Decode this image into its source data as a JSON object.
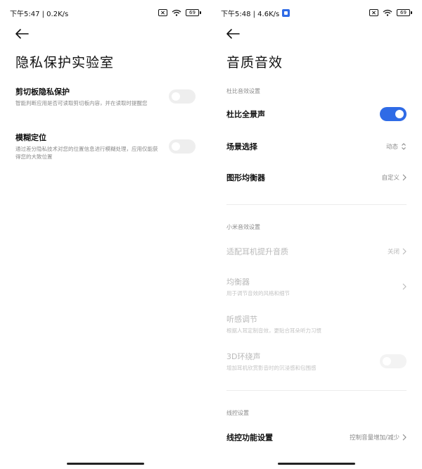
{
  "left": {
    "status": {
      "time": "下午5:47 | 0.2K/s",
      "battery": "69"
    },
    "title": "隐私保护实验室",
    "items": [
      {
        "title": "剪切板隐私保护",
        "subtitle": "智能判断应用是否可读取剪切板内容，并在读取时提醒您",
        "toggle_on": false
      },
      {
        "title": "模糊定位",
        "subtitle": "通过差分隐私技术对您的位置信息进行模糊处理，应用仅能获得您的大致位置",
        "toggle_on": false
      }
    ]
  },
  "right": {
    "status": {
      "time": "下午5:48 | 4.6K/s",
      "battery": "69"
    },
    "title": "音质音效",
    "dolby_section": "杜比音效设置",
    "dolby_atmos": {
      "title": "杜比全景声",
      "toggle_on": true
    },
    "scene": {
      "title": "场景选择",
      "value": "动态"
    },
    "eq_graphic": {
      "title": "图形均衡器",
      "value": "自定义"
    },
    "mi_section": "小米音效设置",
    "headphone": {
      "title": "适配耳机提升音质",
      "value": "关闭"
    },
    "equalizer": {
      "title": "均衡器",
      "subtitle": "用于调节音效的风格和细节"
    },
    "hearing": {
      "title": "听感调节",
      "subtitle": "根据人耳定制音效，更贴合耳朵听力习惯"
    },
    "surround": {
      "title": "3D环绕声",
      "subtitle": "增加耳机欣赏影音时的沉浸感和包围感",
      "toggle_on": false
    },
    "wire_section": "线控设置",
    "wire_control": {
      "title": "线控功能设置",
      "value": "控制音量增加/减少"
    }
  }
}
